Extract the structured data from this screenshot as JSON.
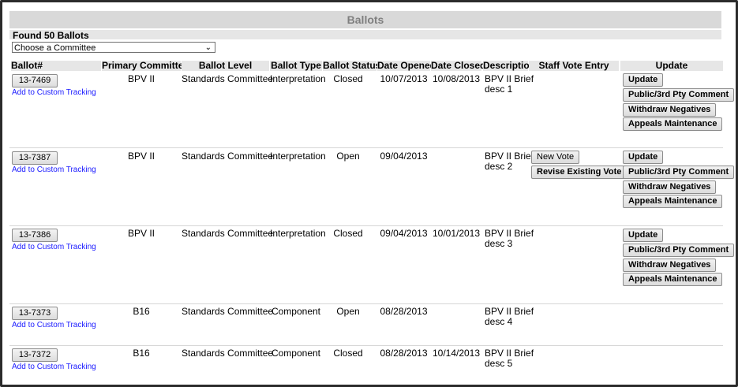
{
  "page": {
    "title": "Ballots",
    "found_text": "Found 50 Ballots",
    "committee_select": {
      "selected": "Choose a Committee"
    }
  },
  "columns": {
    "ballot": "Ballot#",
    "primary_committee": "Primary Committee",
    "ballot_level": "Ballot Level",
    "ballot_type": "Ballot Type",
    "ballot_status": "Ballot Status",
    "date_opened": "Date Opened",
    "date_closed": "Date Closed",
    "description": "Description",
    "staff_vote_entry": "Staff Vote Entry",
    "update": "Update"
  },
  "labels": {
    "add_tracking": "Add to Custom Tracking",
    "update": "Update",
    "public_comment": "Public/3rd Pty Comment",
    "withdraw_negatives": "Withdraw Negatives",
    "appeals_maintenance": "Appeals Maintenance",
    "new_vote": "New Vote",
    "revise_vote": "Revise Existing Vote"
  },
  "rows": [
    {
      "ballot": "13-7469",
      "committee": "BPV II",
      "level": "Standards Committee",
      "type": "Interpretation",
      "status": "Closed",
      "opened": "10/07/2013",
      "closed": "10/08/2013",
      "desc_line1": "BPV II Brief",
      "desc_line2": "desc 1"
    },
    {
      "ballot": "13-7387",
      "committee": "BPV II",
      "level": "Standards Committee",
      "type": "Interpretation",
      "status": "Open",
      "opened": "09/04/2013",
      "closed": "",
      "desc_line1": "BPV II Brief",
      "desc_line2": "desc 2"
    },
    {
      "ballot": "13-7386",
      "committee": "BPV II",
      "level": "Standards Committee",
      "type": "Interpretation",
      "status": "Closed",
      "opened": "09/04/2013",
      "closed": "10/01/2013",
      "desc_line1": "BPV II Brief",
      "desc_line2": "desc 3"
    },
    {
      "ballot": "13-7373",
      "committee": "B16",
      "level": "Standards Committee",
      "type": "Component",
      "status": "Open",
      "opened": "08/28/2013",
      "closed": "",
      "desc_line1": "BPV II Brief",
      "desc_line2": "desc 4"
    },
    {
      "ballot": "13-7372",
      "committee": "B16",
      "level": "Standards Committee",
      "type": "Component",
      "status": "Closed",
      "opened": "08/28/2013",
      "closed": "10/14/2013",
      "desc_line1": "BPV II Brief",
      "desc_line2": "desc 5"
    }
  ]
}
